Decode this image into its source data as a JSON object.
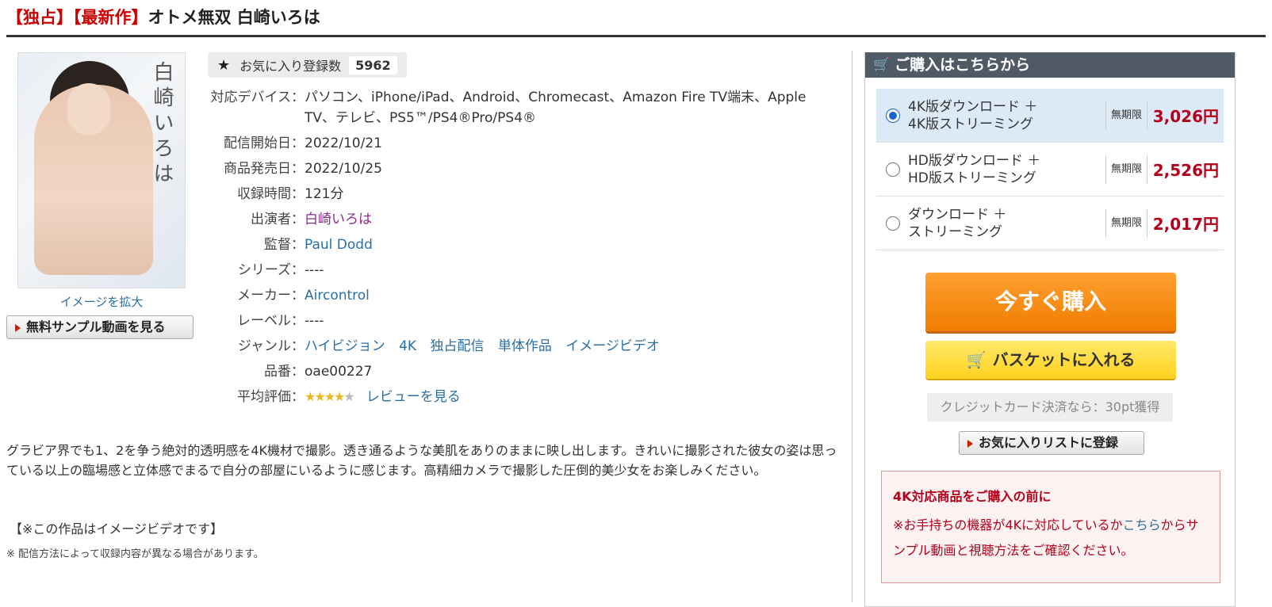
{
  "title": {
    "tag1": "【独占】",
    "tag2": "【最新作】",
    "main": "オトメ無双 白崎いろは"
  },
  "cover": {
    "vertical_text": "白崎いろは",
    "enlarge_label": "イメージを拡大"
  },
  "sample_button": "無料サンプル動画を見る",
  "favorites": {
    "label": "お気に入り登録数",
    "count": "5962"
  },
  "specs": {
    "device_label": "対応デバイス：",
    "device_value": "パソコン、iPhone/iPad、Android、Chromecast、Amazon Fire TV端末、Apple TV、テレビ、PS5™/PS4®Pro/PS4®",
    "start_label": "配信開始日：",
    "start_value": "2022/10/21",
    "release_label": "商品発売日：",
    "release_value": "2022/10/25",
    "duration_label": "収録時間：",
    "duration_value": "121分",
    "cast_label": "出演者：",
    "cast_value": "白崎いろは",
    "director_label": "監督：",
    "director_value": "Paul Dodd",
    "series_label": "シリーズ：",
    "series_value": "----",
    "maker_label": "メーカー：",
    "maker_value": "Aircontrol",
    "label_label": "レーベル：",
    "label_value": "----",
    "genre_label": "ジャンル：",
    "genres": [
      "ハイビジョン",
      "4K",
      "独占配信",
      "単体作品",
      "イメージビデオ"
    ],
    "code_label": "品番：",
    "code_value": "oae00227",
    "rating_label": "平均評価：",
    "rating_stars": 4,
    "review_link": "レビューを見る"
  },
  "description": "グラビア界でも1、2を争う絶対的透明感を4K機材で撮影。透き通るような美肌をありのままに映し出します。きれいに撮影された彼女の姿は思っている以上の臨場感と立体感でまるで自分の部屋にいるように感じます。高精細カメラで撮影した圧倒的美少女をお楽しみください。",
  "note1": "【※この作品はイメージビデオです】",
  "note2": "※ 配信方法によって収録内容が異なる場合があります。",
  "purchase": {
    "heading": "ご購入はこちらから",
    "options": [
      {
        "line1": "4K版ダウンロード ＋",
        "line2": "4K版ストリーミング",
        "term": "無期限",
        "price": "3,026円",
        "selected": true
      },
      {
        "line1": "HD版ダウンロード ＋",
        "line2": "HD版ストリーミング",
        "term": "無期限",
        "price": "2,526円",
        "selected": false
      },
      {
        "line1": "ダウンロード ＋",
        "line2": "ストリーミング",
        "term": "無期限",
        "price": "2,017円",
        "selected": false
      }
    ],
    "buy_now": "今すぐ購入",
    "basket": "バスケットに入れる",
    "credit_note": "クレジットカード決済なら：30pt獲得",
    "favorite_list": "お気に入りリストに登録"
  },
  "warning": {
    "title": "4K対応商品をご購入の前に",
    "body_before": "※お手持ちの機器が4Kに対応しているか",
    "body_link": "こちら",
    "body_after": "からサンプル動画と視聴方法をご確認ください。"
  },
  "colors": {
    "accent_red": "#b3001b",
    "link_blue": "#2a6ea6",
    "buy_orange": "#f07d00",
    "basket_yellow": "#ffd21e",
    "panel_header": "#4f5a66"
  },
  "icons": {
    "favorite": "star-icon",
    "cart": "cart-icon",
    "sample": "play-triangle-icon"
  }
}
